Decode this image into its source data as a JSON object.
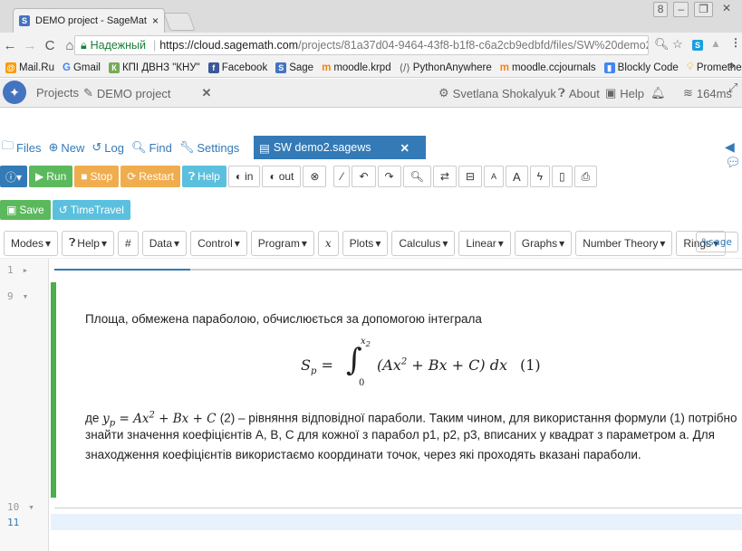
{
  "browser": {
    "tab_title": "DEMO project - SageMat",
    "tab_close": "×",
    "window_buttons": [
      "8",
      "–",
      "❐",
      "✕"
    ],
    "secure_label": "Надежный",
    "url_host": "https://cloud.sagemath.com",
    "url_path": "/projects/81a37d04-9464-43f8-b1f8-c6a2cb9edbfd/files/SW%20demo2",
    "bookmarks": [
      "Mail.Ru",
      "Gmail",
      "КПІ ДВНЗ \"КНУ\"",
      "Facebook",
      "Sage",
      "moodle.krpd",
      "PythonAnywhere",
      "moodle.ccjournals",
      "Blockly Code",
      "Prometheus"
    ],
    "bookmarks_more": "»"
  },
  "cocalc": {
    "projects_label": "Projects",
    "project_name": "DEMO project",
    "user_name": "Svetlana Shokalyuk",
    "about_label": "About",
    "help_label": "Help",
    "ping": "164ms"
  },
  "filebar": {
    "files": "Files",
    "new": "New",
    "log": "Log",
    "find": "Find",
    "settings": "Settings",
    "open_file": "SW demo2.sagews"
  },
  "toolbar": {
    "run": "Run",
    "stop": "Stop",
    "restart": "Restart",
    "help": "Help",
    "in": "in",
    "out": "out",
    "save": "Save",
    "timetravel": "TimeTravel"
  },
  "menus": [
    "Modes",
    "Help",
    "#",
    "Data",
    "Control",
    "Program",
    "x",
    "Plots",
    "Calculus",
    "Linear",
    "Graphs",
    "Number Theory",
    "Rings"
  ],
  "mode_tag": "%sage",
  "editor": {
    "line_numbers": [
      "1",
      "9",
      "10",
      "11"
    ],
    "para1": "Площа, обмежена параболою, обчислюється за допомогою інтеграла",
    "formula_label": "(1)",
    "para2_a": "де",
    "para2_b": "(2) – рівняння відповідної параболи. Таким чином, для використання формули (1) потрібно",
    "para2_line2": "знайти значення коефіцієнтів A, B, C для кожної з парабол p1, p2, p3, вписаних у квадрат з параметром a. Для",
    "para2_line3": "знаходження коефіцієнтів використаємо координати точок, через які проходять вказані параболи."
  }
}
